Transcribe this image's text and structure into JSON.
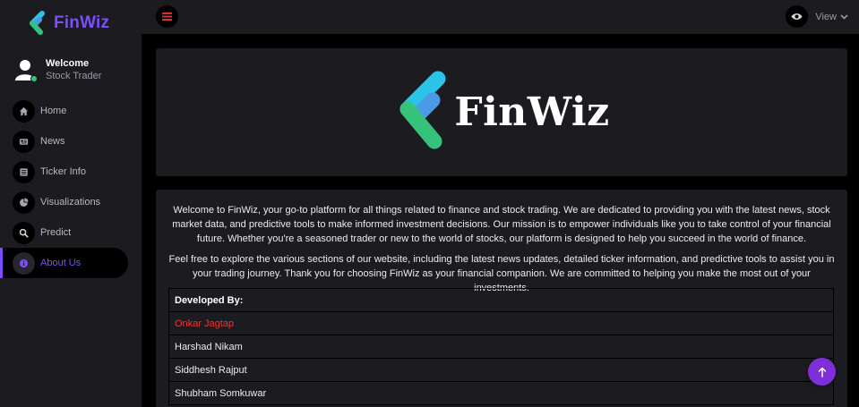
{
  "brand": {
    "name": "FinWiz",
    "accent": "#7c4dff"
  },
  "user": {
    "name": "Welcome",
    "role": "Stock Trader"
  },
  "nav": [
    {
      "label": "Home",
      "icon": "home-icon"
    },
    {
      "label": "News",
      "icon": "newspaper-icon"
    },
    {
      "label": "Ticker Info",
      "icon": "list-icon"
    },
    {
      "label": "Visualizations",
      "icon": "pie-chart-icon"
    },
    {
      "label": "Predict",
      "icon": "search-icon"
    },
    {
      "label": "About Us",
      "icon": "info-icon",
      "active": true
    }
  ],
  "topbar": {
    "view_label": "View"
  },
  "hero": {
    "name": "FinWiz"
  },
  "about": {
    "paragraph1": "Welcome to FinWiz, your go-to platform for all things related to finance and stock trading. We are dedicated to providing you with the latest news, stock market data, and predictive tools to make informed investment decisions. Our mission is to empower individuals like you to take control of your financial future. Whether you're a seasoned trader or new to the world of stocks, our platform is designed to help you succeed in the world of finance.",
    "paragraph2": "Feel free to explore the various sections of our website, including the latest news updates, detailed ticker information, and predictive tools to assist you in your trading journey. Thank you for choosing FinWiz as your financial companion. We are committed to helping you make the most out of your investments.",
    "developers_heading": "Developed By:",
    "developers": [
      "Onkar Jagtap",
      "Harshad Nikam",
      "Siddhesh Rajput",
      "Shubham Somkuwar"
    ]
  },
  "colors": {
    "sidebar_bg": "#1b1b20",
    "highlight_red": "#e53935",
    "scroll_button": "#7e2fd9"
  }
}
